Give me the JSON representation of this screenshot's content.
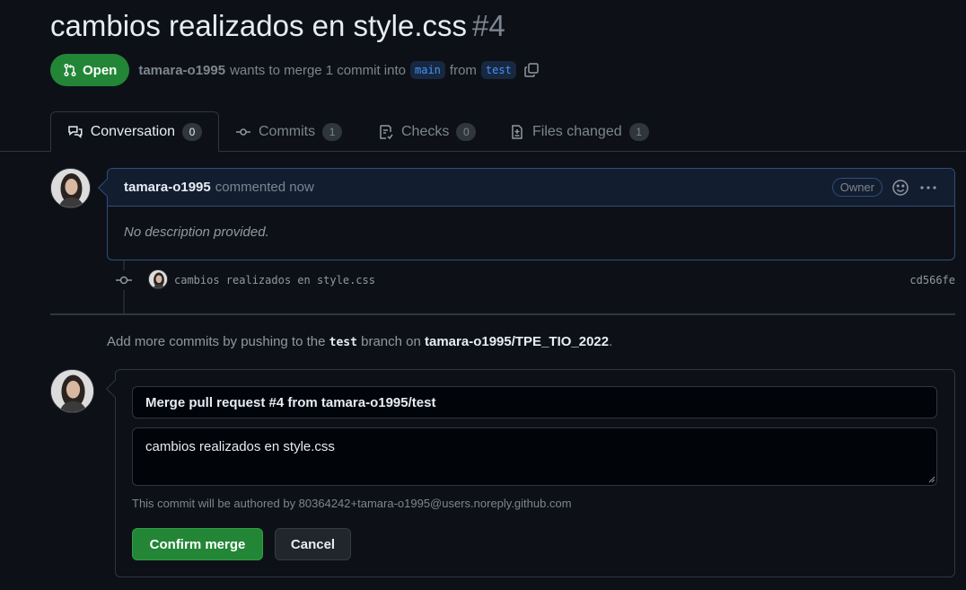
{
  "pr": {
    "title": "cambios realizados en style.css",
    "number": "#4",
    "state": "Open",
    "author": "tamara-o1995",
    "merge_text_1": "wants to merge 1 commit into",
    "base_branch": "main",
    "merge_text_2": "from",
    "head_branch": "test"
  },
  "tabs": [
    {
      "label": "Conversation",
      "count": "0"
    },
    {
      "label": "Commits",
      "count": "1"
    },
    {
      "label": "Checks",
      "count": "0"
    },
    {
      "label": "Files changed",
      "count": "1"
    }
  ],
  "comment": {
    "author": "tamara-o1995",
    "action": "commented now",
    "role": "Owner",
    "body": "No description provided."
  },
  "commit": {
    "message": "cambios realizados en style.css",
    "sha": "cd566fe"
  },
  "push_hint": {
    "prefix": "Add more commits by pushing to the",
    "branch": "test",
    "middle": "branch on",
    "repo": "tamara-o1995/TPE_TIO_2022",
    "suffix": "."
  },
  "merge": {
    "title_value": "Merge pull request #4 from tamara-o1995/test",
    "body_value": "cambios realizados en style.css",
    "author_note": "This commit will be authored by 80364242+tamara-o1995@users.noreply.github.com",
    "confirm_label": "Confirm merge",
    "cancel_label": "Cancel"
  },
  "colors": {
    "background": "#0d1117",
    "open_green": "#238636",
    "branch_blue": "#4493f8",
    "comment_header": "#121d2f"
  }
}
